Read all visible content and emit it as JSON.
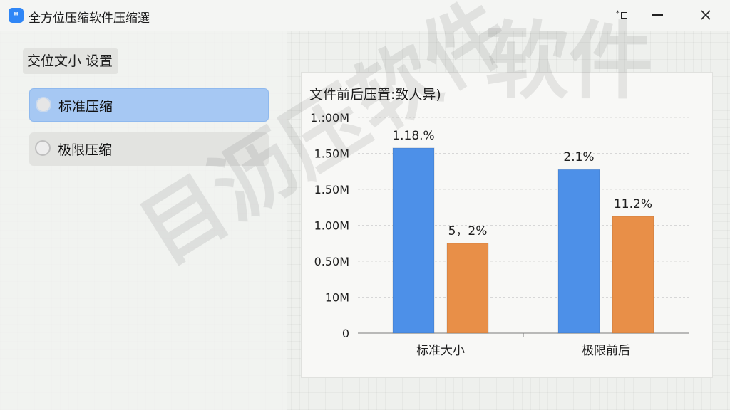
{
  "window": {
    "title": "全方位压缩软件压缩選",
    "icon": "app-logo-icon",
    "pin_glyph": "*⊐",
    "accent": "#2f86f6"
  },
  "sidebar": {
    "section_label": "交位文小 设置",
    "options": [
      {
        "label": "标准压缩",
        "selected": true
      },
      {
        "label": "极限压缩",
        "selected": false
      }
    ],
    "selected_color": "#a6c8f3"
  },
  "chart": {
    "title": "文件前后压置:致人异)"
  },
  "chart_data": {
    "type": "bar",
    "title": "文件前后压置:致人异)",
    "categories": [
      "标准大小",
      "极限前后"
    ],
    "y_tick_labels": [
      "0",
      "10M",
      "0.50M",
      "1.00M",
      "1.50M",
      "1.50M",
      "1.:00M"
    ],
    "series": [
      {
        "color": "#4d90e8",
        "values": [
          5.15,
          4.55
        ],
        "labels": [
          "1.18.%",
          "2.1%"
        ]
      },
      {
        "color": "#e88f48",
        "values": [
          2.5,
          3.25
        ],
        "labels": [
          "5，2%",
          "11.2%"
        ]
      }
    ],
    "ylim": [
      0,
      6
    ],
    "grid": true,
    "legend": "none"
  },
  "watermark": {
    "text_top": "软件",
    "text_diag": "目沥压软件"
  }
}
